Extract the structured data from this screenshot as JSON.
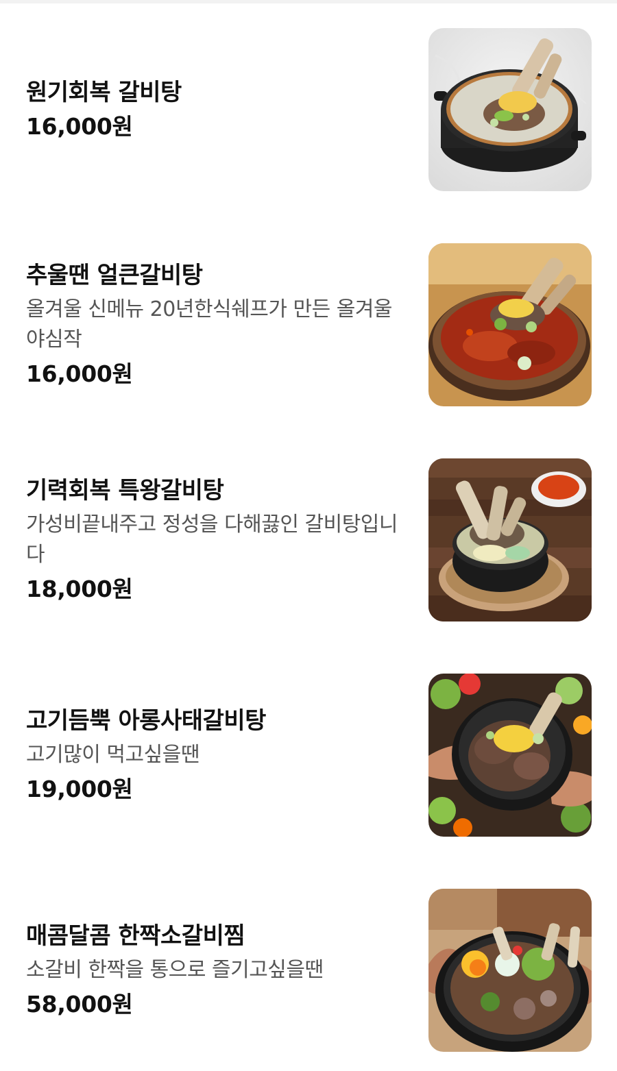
{
  "menu": {
    "items": [
      {
        "name": "원기회복 갈비탕",
        "description": "",
        "price": "16,000원",
        "image_icon": "galbitang-clear-soup-photo"
      },
      {
        "name": "추울땐 얼큰갈비탕",
        "description": "올겨울 신메뉴 20년한식쉐프가 만든 올겨울 야심작",
        "price": "16,000원",
        "image_icon": "spicy-galbitang-photo"
      },
      {
        "name": "기력회복 특왕갈비탕",
        "description": "가성비끝내주고 정성을 다해끓인 갈비탕입니다",
        "price": "18,000원",
        "image_icon": "king-galbitang-photo"
      },
      {
        "name": "고기듬뿍 아롱사태갈비탕",
        "description": "고기많이 먹고싶을땐",
        "price": "19,000원",
        "image_icon": "shank-galbitang-photo"
      },
      {
        "name": "매콤달콤 한짝소갈비찜",
        "description": "소갈비 한짝을 통으로 즐기고싶을땐",
        "price": "58,000원",
        "image_icon": "braised-short-ribs-photo"
      }
    ]
  }
}
